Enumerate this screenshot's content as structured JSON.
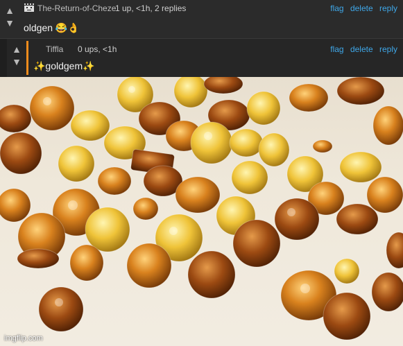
{
  "comment1": {
    "username": "The-Return-of-Cheze",
    "meta": "1 up, <1h, 2 replies",
    "text": "oldgen 😂👌",
    "actions": [
      "flag",
      "delete",
      "reply"
    ]
  },
  "comment2": {
    "username": "Tiffla",
    "meta": "0 ups, <1h",
    "text": "✨goldgem✨",
    "actions": [
      "flag",
      "delete",
      "reply"
    ]
  },
  "icons": {
    "upvote": "▲",
    "downvote": "▼"
  },
  "colors": {
    "link": "#3fa7e8",
    "reply_accent": "#f28c1c"
  },
  "photo": {
    "subject": "scattered amber and yellow gemstones",
    "watermark": "imgflip.com"
  }
}
